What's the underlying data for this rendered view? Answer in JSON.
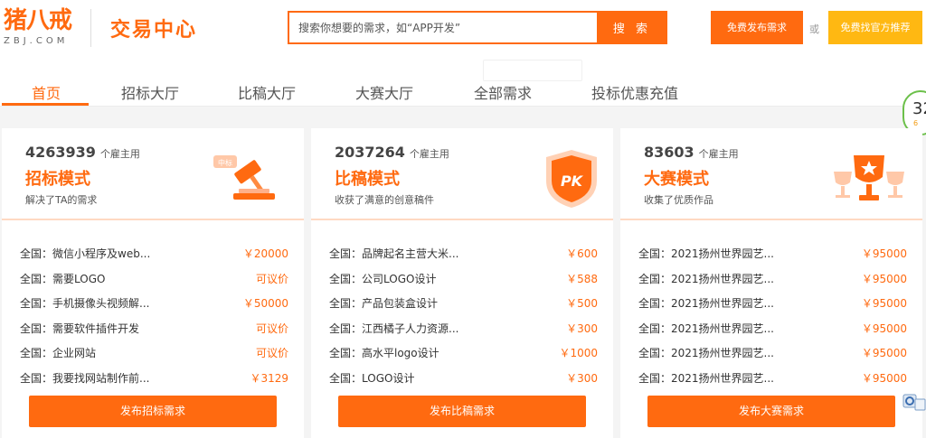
{
  "header": {
    "logo_cn": "猪八戒",
    "logo_en": "ZBJ.COM",
    "section_title": "交易中心",
    "search": {
      "placeholder": "搜索你想要的需求，如“APP开发”",
      "button": "搜 索"
    },
    "publish_button": "免费发布需求",
    "or_text": "或",
    "official_button": "免费找官方推荐"
  },
  "nav": {
    "items": [
      {
        "label": "首页"
      },
      {
        "label": "招标大厅"
      },
      {
        "label": "比稿大厅"
      },
      {
        "label": "大赛大厅"
      },
      {
        "label": "全部需求"
      },
      {
        "label": "投标优惠充值"
      }
    ],
    "active_index": 0
  },
  "float_badge": {
    "number": "32",
    "small": "6"
  },
  "cards": [
    {
      "count": "4263939",
      "unit": "个雇主用",
      "title": "招标模式",
      "desc": "解决了TA的需求",
      "icon": "gavel-icon",
      "icon_tag": "中标",
      "rows": [
        {
          "title": "全国：微信小程序及web...",
          "price": "￥20000"
        },
        {
          "title": "全国：需要LOGO",
          "price": "可议价"
        },
        {
          "title": "全国：手机摄像头视频解...",
          "price": "￥50000"
        },
        {
          "title": "全国：需要软件插件开发",
          "price": "可议价"
        },
        {
          "title": "全国：企业网站",
          "price": "可议价"
        },
        {
          "title": "全国：我要找网站制作前...",
          "price": "￥3129"
        }
      ],
      "button": "发布招标需求"
    },
    {
      "count": "2037264",
      "unit": "个雇主用",
      "title": "比稿模式",
      "desc": "收获了满意的创意稿件",
      "icon": "pk-shield-icon",
      "icon_text": "PK",
      "rows": [
        {
          "title": "全国：品牌起名主营大米...",
          "price": "￥600"
        },
        {
          "title": "全国：公司LOGO设计",
          "price": "￥588"
        },
        {
          "title": "全国：产品包装盒设计",
          "price": "￥500"
        },
        {
          "title": "全国：江西橘子人力资源...",
          "price": "￥300"
        },
        {
          "title": "全国：高水平logo设计",
          "price": "￥1000"
        },
        {
          "title": "全国：LOGO设计",
          "price": "￥300"
        }
      ],
      "button": "发布比稿需求"
    },
    {
      "count": "83603",
      "unit": "个雇主用",
      "title": "大赛模式",
      "desc": "收集了优质作品",
      "icon": "trophy-icon",
      "rows": [
        {
          "title": "全国：2021扬州世界园艺...",
          "price": "￥95000"
        },
        {
          "title": "全国：2021扬州世界园艺...",
          "price": "￥95000"
        },
        {
          "title": "全国：2021扬州世界园艺...",
          "price": "￥95000"
        },
        {
          "title": "全国：2021扬州世界园艺...",
          "price": "￥95000"
        },
        {
          "title": "全国：2021扬州世界园艺...",
          "price": "￥95000"
        },
        {
          "title": "全国：2021扬州世界园艺...",
          "price": "￥95000"
        }
      ],
      "button": "发布大赛需求"
    }
  ],
  "colors": {
    "accent": "#ff6a10",
    "official": "#ffb812",
    "badge_border": "#6cc04a"
  }
}
